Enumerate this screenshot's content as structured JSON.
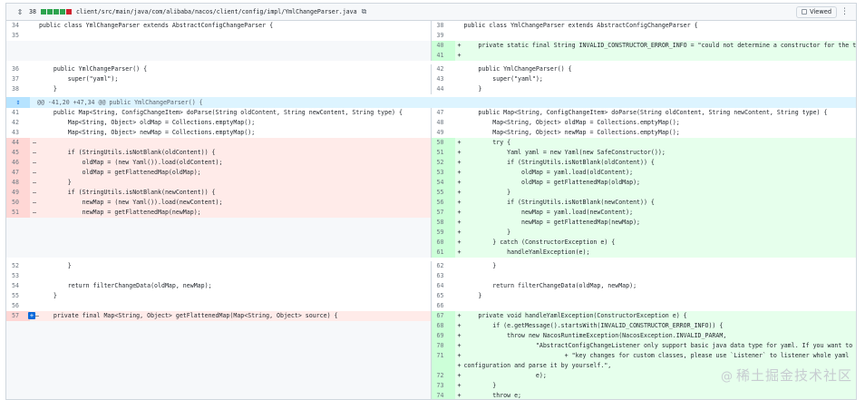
{
  "file": {
    "change_count": "38",
    "path": "client/src/main/java/com/alibaba/nacos/client/config/impl/YmlChangeParser.java",
    "viewed_label": "Viewed",
    "diffstat_colors": [
      "#2da44e",
      "#2da44e",
      "#2da44e",
      "#2da44e",
      "#cf222e"
    ]
  },
  "rows": [
    {
      "type": "ctx",
      "ln": "34",
      "rn": "38",
      "lt": "public class YmlChangeParser extends AbstractConfigChangeParser {",
      "rt": "public class YmlChangeParser extends AbstractConfigChangeParser {",
      "h": 11
    },
    {
      "type": "ctx",
      "ln": "35",
      "rn": "39",
      "lt": "",
      "rt": "",
      "h": 11
    },
    {
      "type": "add",
      "ln": "",
      "rn": "40",
      "lt": "",
      "rt": "    private static final String INVALID_CONSTRUCTOR_ERROR_INFO = \"could not determine a constructor for the tag\";",
      "h": 11
    },
    {
      "type": "add",
      "ln": "",
      "rn": "41",
      "lt": "",
      "rt": "",
      "h": 11
    },
    {
      "type": "spacer",
      "h": 4
    },
    {
      "type": "ctx",
      "ln": "36",
      "rn": "42",
      "lt": "    public YmlChangeParser() {",
      "rt": "    public YmlChangeParser() {",
      "h": 11
    },
    {
      "type": "ctx",
      "ln": "37",
      "rn": "43",
      "lt": "        super(\"yaml\");",
      "rt": "        super(\"yaml\");",
      "h": 11
    },
    {
      "type": "ctx",
      "ln": "38",
      "rn": "44",
      "lt": "    }",
      "rt": "    }",
      "h": 11
    },
    {
      "type": "spacer",
      "h": 3
    },
    {
      "type": "hunk",
      "text": "@@ -41,20 +47,34 @@ public YmlChangeParser() {",
      "h": 12
    },
    {
      "type": "ctx",
      "ln": "41",
      "rn": "47",
      "lt": "    public Map<String, ConfigChangeItem> doParse(String oldContent, String newContent, String type) {",
      "rt": "    public Map<String, ConfigChangeItem> doParse(String oldContent, String newContent, String type) {",
      "h": 11
    },
    {
      "type": "ctx",
      "ln": "42",
      "rn": "48",
      "lt": "        Map<String, Object> oldMap = Collections.emptyMap();",
      "rt": "        Map<String, Object> oldMap = Collections.emptyMap();",
      "h": 11
    },
    {
      "type": "ctx",
      "ln": "43",
      "rn": "49",
      "lt": "        Map<String, Object> newMap = Collections.emptyMap();",
      "rt": "        Map<String, Object> newMap = Collections.emptyMap();",
      "h": 11
    },
    {
      "type": "mod",
      "ln": "44",
      "rn": "50",
      "lt": "",
      "rt": "        try {",
      "h": 11
    },
    {
      "type": "mod",
      "ln": "45",
      "rn": "51",
      "lt": "        if (StringUtils.isNotBlank(oldContent)) {",
      "rt": "            Yaml yaml = new Yaml(new SafeConstructor());",
      "h": 11
    },
    {
      "type": "mod",
      "ln": "46",
      "rn": "52",
      "lt": "            oldMap = (new Yaml()).load(oldContent);",
      "rt": "            if (StringUtils.isNotBlank(oldContent)) {",
      "h": 11
    },
    {
      "type": "mod",
      "ln": "47",
      "rn": "53",
      "lt": "            oldMap = getFlattenedMap(oldMap);",
      "rt": "                oldMap = yaml.load(oldContent);",
      "h": 11
    },
    {
      "type": "mod",
      "ln": "48",
      "rn": "54",
      "lt": "        }",
      "rt": "                oldMap = getFlattenedMap(oldMap);",
      "h": 11
    },
    {
      "type": "mod",
      "ln": "49",
      "rn": "55",
      "lt": "        if (StringUtils.isNotBlank(newContent)) {",
      "rt": "            }",
      "h": 11
    },
    {
      "type": "mod",
      "ln": "50",
      "rn": "56",
      "lt": "            newMap = (new Yaml()).load(newContent);",
      "rt": "            if (StringUtils.isNotBlank(newContent)) {",
      "h": 11
    },
    {
      "type": "mod",
      "ln": "51",
      "rn": "57",
      "lt": "            newMap = getFlattenedMap(newMap);",
      "rt": "                newMap = yaml.load(newContent);",
      "h": 11
    },
    {
      "type": "add",
      "ln": "",
      "rn": "58",
      "lt": "",
      "rt": "                newMap = getFlattenedMap(newMap);",
      "h": 11
    },
    {
      "type": "add",
      "ln": "",
      "rn": "59",
      "lt": "",
      "rt": "            }",
      "h": 11
    },
    {
      "type": "add",
      "ln": "",
      "rn": "60",
      "lt": "",
      "rt": "        } catch (ConstructorException e) {",
      "h": 11
    },
    {
      "type": "add",
      "ln": "",
      "rn": "61",
      "lt": "",
      "rt": "            handleYamlException(e);",
      "h": 11
    },
    {
      "type": "spacer",
      "h": 4
    },
    {
      "type": "ctx",
      "ln": "52",
      "rn": "62",
      "lt": "        }",
      "rt": "        }",
      "h": 11
    },
    {
      "type": "ctx",
      "ln": "53",
      "rn": "63",
      "lt": "",
      "rt": "",
      "h": 11
    },
    {
      "type": "ctx",
      "ln": "54",
      "rn": "64",
      "lt": "        return filterChangeData(oldMap, newMap);",
      "rt": "        return filterChangeData(oldMap, newMap);",
      "h": 11
    },
    {
      "type": "ctx",
      "ln": "55",
      "rn": "65",
      "lt": "    }",
      "rt": "    }",
      "h": 11
    },
    {
      "type": "ctx",
      "ln": "56",
      "rn": "66",
      "lt": "",
      "rt": "",
      "h": 11
    },
    {
      "type": "mod",
      "ln": "57",
      "rn": "67",
      "lt": "    private final Map<String, Object> getFlattenedMap(Map<String, Object> source) {",
      "rt": "    private void handleYamlException(ConstructorException e) {",
      "h": 11,
      "expand": true
    },
    {
      "type": "add",
      "ln": "",
      "rn": "68",
      "lt": "",
      "rt": "        if (e.getMessage().startsWith(INVALID_CONSTRUCTOR_ERROR_INFO)) {",
      "h": 11
    },
    {
      "type": "add",
      "ln": "",
      "rn": "69",
      "lt": "",
      "rt": "            throw new NacosRuntimeException(NacosException.INVALID_PARAM,",
      "h": 11
    },
    {
      "type": "add",
      "ln": "",
      "rn": "70",
      "lt": "",
      "rt": "                    \"AbstractConfigChangeListener only support basic java data type for yaml. If you want to listen \"",
      "h": 11
    },
    {
      "type": "add",
      "ln": "",
      "rn": "71",
      "lt": "",
      "rt": "                            + \"key changes for custom classes, please use `Listener` to listener whole yaml",
      "h": 11
    },
    {
      "type": "add",
      "ln": "",
      "rn": "",
      "lt": "",
      "rt": "configuration and parse it by yourself.\",",
      "h": 11
    },
    {
      "type": "add",
      "ln": "",
      "rn": "72",
      "lt": "",
      "rt": "                    e);",
      "h": 11
    },
    {
      "type": "add",
      "ln": "",
      "rn": "73",
      "lt": "",
      "rt": "        }",
      "h": 11
    },
    {
      "type": "add",
      "ln": "",
      "rn": "74",
      "lt": "",
      "rt": "        throw e;",
      "h": 11
    },
    {
      "type": "add",
      "ln": "",
      "rn": "75",
      "lt": "",
      "rt": "    }",
      "h": 11
    }
  ],
  "watermark": {
    "at": "@",
    "text": "稀土掘金技术社区"
  }
}
